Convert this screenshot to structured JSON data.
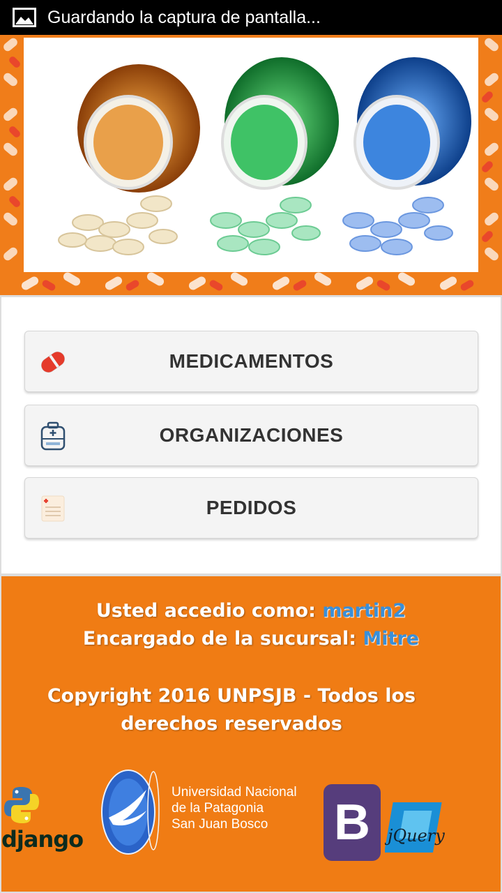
{
  "status_bar": {
    "notification_icon": "image-icon",
    "text": "Guardando la captura de pantalla..."
  },
  "banner": {
    "image": "pill-bottles-photo",
    "bottle_colors": [
      "#e88a1c",
      "#2fae52",
      "#2f7fd6"
    ]
  },
  "menu": {
    "items": [
      {
        "label": "MEDICAMENTOS",
        "icon": "pill-capsule-icon"
      },
      {
        "label": "ORGANIZACIONES",
        "icon": "first-aid-kit-icon"
      },
      {
        "label": "PEDIDOS",
        "icon": "prescription-note-icon"
      }
    ]
  },
  "footer": {
    "user_prefix": "Usted accedio como:",
    "username": "martin2",
    "branch_prefix": "Encargado de la sucursal:",
    "branch": "Mitre",
    "copyright_line1": "Copyright 2016 UNPSJB - Todos los",
    "copyright_line2": "derechos reservados",
    "logos": {
      "django_word": "django",
      "university_line1": "Universidad Nacional",
      "university_line2": "de la Patagonia",
      "university_line3": "San Juan Bosco",
      "bootstrap_letter": "B",
      "jquery_word": "jQuery"
    }
  },
  "colors": {
    "accent_orange": "#f07c14",
    "username_blue": "#3a8fd8",
    "button_bg": "#f4f4f4",
    "bootstrap_purple": "#563d7c"
  }
}
